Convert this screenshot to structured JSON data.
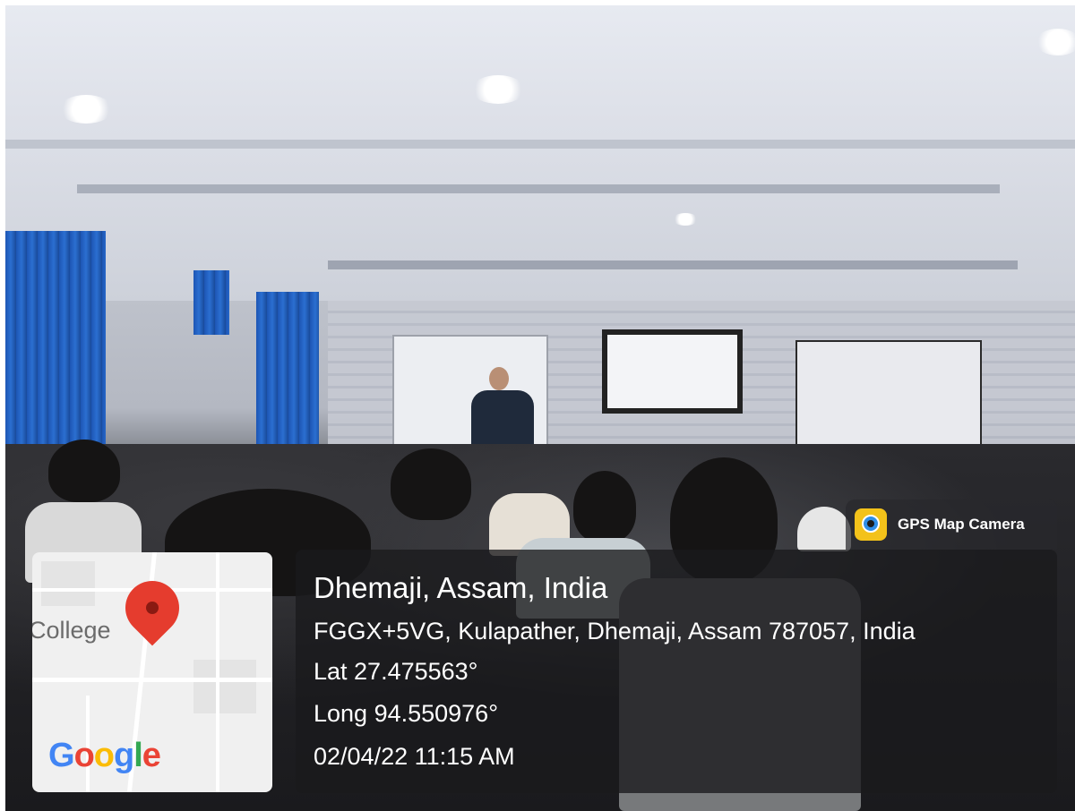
{
  "overlay": {
    "app_name": "GPS Map Camera",
    "map": {
      "place_label": "College",
      "brand": "Google",
      "brand_letters": [
        {
          "ch": "G",
          "color": "#4285F4"
        },
        {
          "ch": "o",
          "color": "#EA4335"
        },
        {
          "ch": "o",
          "color": "#FBBC05"
        },
        {
          "ch": "g",
          "color": "#4285F4"
        },
        {
          "ch": "l",
          "color": "#34A853"
        },
        {
          "ch": "e",
          "color": "#EA4335"
        }
      ],
      "pin_color": "#E53C2E"
    },
    "location": {
      "place": "Dhemaji, Assam, India",
      "address": "FGGX+5VG, Kulapather, Dhemaji, Assam 787057, India",
      "lat": "Lat 27.475563°",
      "long": "Long 94.550976°",
      "datetime": "02/04/22 11:15 AM"
    }
  },
  "scene": {
    "description_colors": {
      "curtain": "#1D55B4",
      "ceiling": "#E7EAF1",
      "audience": "#1A1A1D"
    }
  }
}
